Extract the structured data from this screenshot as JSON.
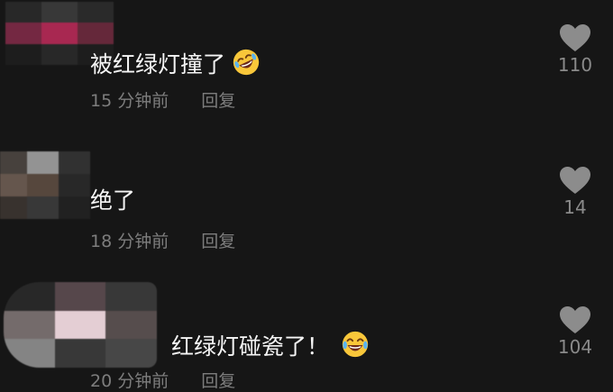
{
  "comments": [
    {
      "text": "被红绿灯撞了",
      "emoji": "rolling-on-floor-laughing-emoji",
      "time": "15 分钟前",
      "reply": "回复",
      "likes": "110",
      "avatar_colors": [
        "#2a2a2a",
        "#3a3a3a",
        "#2c2c2c",
        "#7a2a45",
        "#b02a55",
        "#6a2a3c",
        "#1e1e1e",
        "#2a2a2a",
        "#1e1e1e"
      ]
    },
    {
      "text": "绝了",
      "time": "18 分钟前",
      "reply": "回复",
      "likes": "14",
      "avatar_colors": [
        "#4a4440",
        "#9a9a9a",
        "#333333",
        "#6a5a50",
        "#5a4a40",
        "#2a2a2a",
        "#3a3430",
        "#3a3a3a",
        "#222222"
      ]
    },
    {
      "text": "红绿灯碰瓷了！",
      "emoji": "crying-laughing-emoji",
      "time": "20 分钟前",
      "reply": "回复",
      "likes": "104",
      "avatar_colors": [
        "#2a2a2a",
        "#5a4a4e",
        "#3a3a3a",
        "#7a7070",
        "#f0d8df",
        "#5a5050",
        "#8a8a8a",
        "#3a3a3a",
        "#4a4a4a"
      ]
    }
  ],
  "icons": {
    "like": "heart-icon"
  },
  "colors": {
    "background": "#161616",
    "text": "#f5f5f5",
    "meta": "#7d7d7d",
    "heart": "#8c8c8c"
  }
}
